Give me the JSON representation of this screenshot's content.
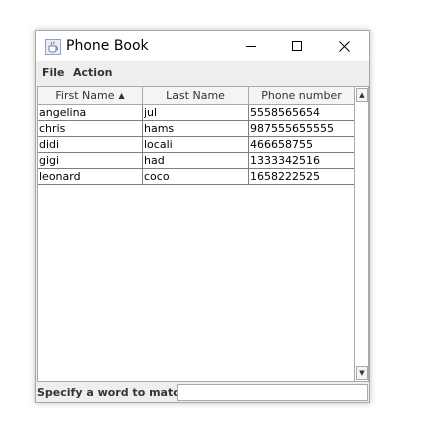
{
  "window": {
    "title": "Phone Book"
  },
  "menu": {
    "file": "File",
    "action": "Action"
  },
  "table": {
    "columns": [
      "First Name",
      "Last Name",
      "Phone number"
    ],
    "rows": [
      [
        "angelina",
        "jul",
        "5558565654"
      ],
      [
        "chris",
        "hams",
        "987555655555"
      ],
      [
        "didi",
        "locali",
        "466658755"
      ],
      [
        "gigi",
        "had",
        "1333342516"
      ],
      [
        "leonard",
        "coco",
        "1658222525"
      ]
    ]
  },
  "filter": {
    "label": "Specify a word to match:",
    "value": ""
  },
  "icons": {
    "app": "java-coffee-icon",
    "minimize": "minimize-icon",
    "maximize": "maximize-icon",
    "close": "close-icon",
    "sort": "sort-ascending-icon",
    "scroll_up": "scroll-up-icon",
    "scroll_down": "scroll-down-icon"
  }
}
